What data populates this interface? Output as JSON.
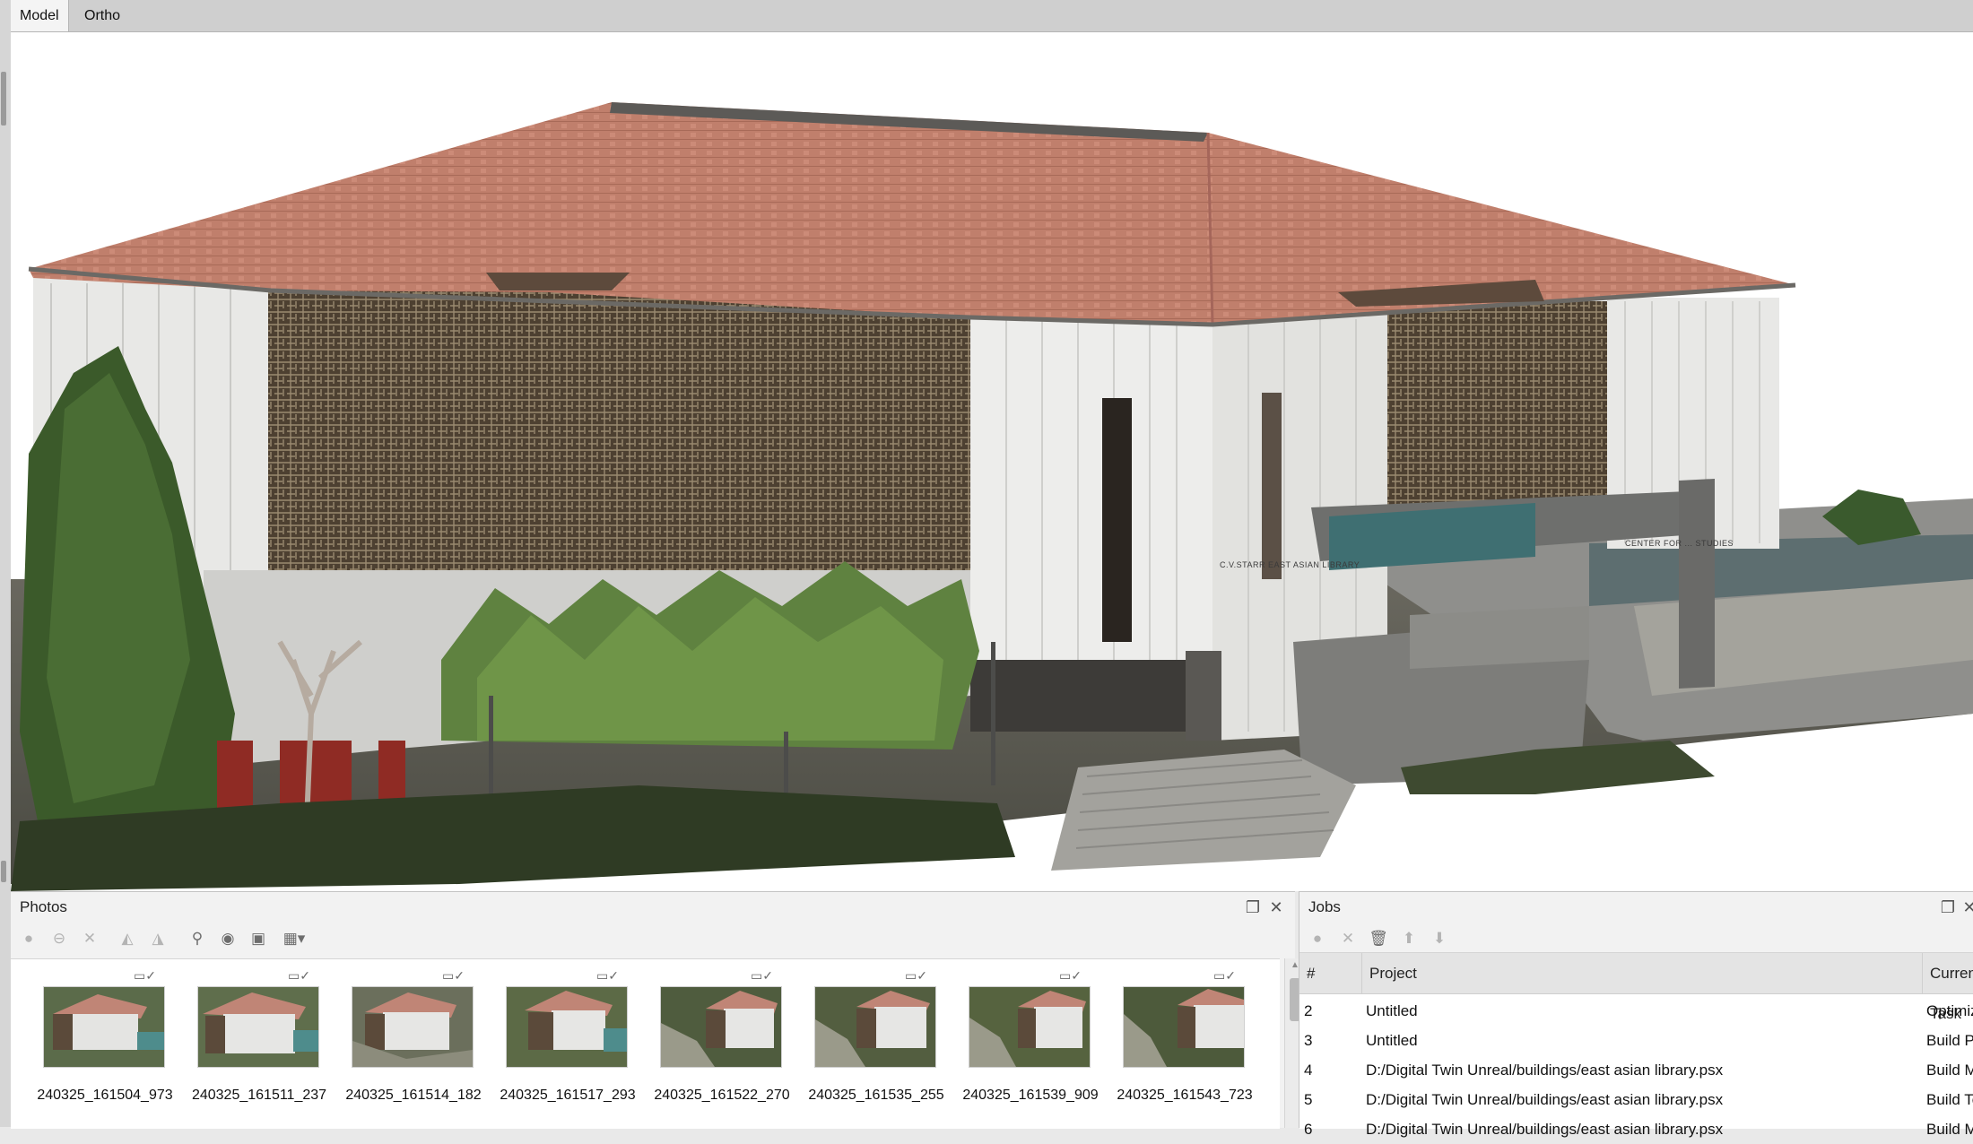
{
  "tabs": [
    {
      "label": "Model",
      "active": true
    },
    {
      "label": "Ortho",
      "active": false
    }
  ],
  "model_view": {
    "sign_library": "C.V.STARR EAST ASIAN LIBRARY",
    "sign_center": "CENTER FOR ... STUDIES"
  },
  "photos_panel": {
    "title": "Photos",
    "toolbar_icons": [
      "enable-icon",
      "disable-icon",
      "remove-icon",
      "rotate-left-icon",
      "rotate-right-icon",
      "filter-icon",
      "view-icon",
      "thumbnail-icon",
      "grid-dropdown-icon"
    ],
    "photos": [
      {
        "label": "240325_161504_973",
        "checked": true
      },
      {
        "label": "240325_161511_237",
        "checked": true
      },
      {
        "label": "240325_161514_182",
        "checked": true
      },
      {
        "label": "240325_161517_293",
        "checked": true
      },
      {
        "label": "240325_161522_270",
        "checked": true
      },
      {
        "label": "240325_161535_255",
        "checked": true
      },
      {
        "label": "240325_161539_909",
        "checked": true
      },
      {
        "label": "240325_161543_723",
        "checked": true
      }
    ]
  },
  "jobs_panel": {
    "title": "Jobs",
    "toolbar_icons": [
      "run-icon",
      "cancel-icon",
      "delete-icon",
      "move-up-icon",
      "move-down-icon"
    ],
    "columns": [
      "#",
      "Project",
      "Current Task"
    ],
    "rows": [
      {
        "num": "2",
        "project": "Untitled",
        "task": "Optimize Alignm"
      },
      {
        "num": "3",
        "project": "Untitled",
        "task": "Build Point Clou"
      },
      {
        "num": "4",
        "project": "D:/Digital Twin Unreal/buildings/east asian library.psx",
        "task": "Build Model"
      },
      {
        "num": "5",
        "project": "D:/Digital Twin Unreal/buildings/east asian library.psx",
        "task": "Build Texture"
      },
      {
        "num": "6",
        "project": "D:/Digital Twin Unreal/buildings/east asian library.psx",
        "task": "Build Model"
      }
    ]
  }
}
